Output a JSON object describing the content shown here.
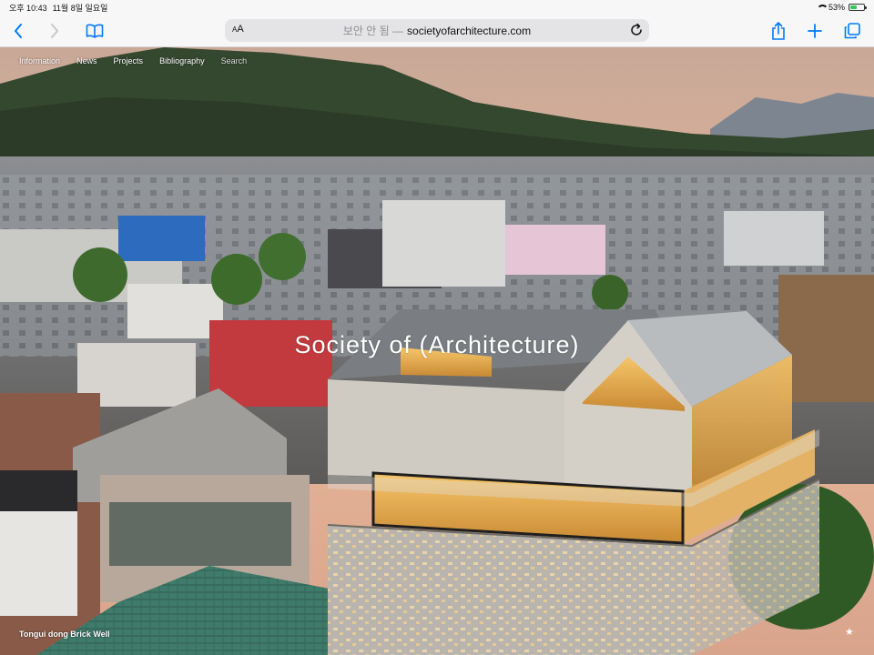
{
  "status_bar": {
    "time": "오후 10:43",
    "date": "11월 8일 일요일",
    "battery": "53%",
    "battery_level": 0.53
  },
  "browser": {
    "aa_label": "AA",
    "url_prefix": "보안 안 됨 —",
    "url": "societyofarchitecture.com",
    "icons": {
      "back": "chevron-left-icon",
      "forward": "chevron-right-icon",
      "bookmarks": "book-icon",
      "reload": "reload-icon",
      "share": "share-icon",
      "new_tab": "plus-icon",
      "tabs": "tabs-icon"
    }
  },
  "site": {
    "nav": [
      "Information",
      "News",
      "Projects",
      "Bibliography",
      "Search"
    ],
    "title": "Society of (Architecture)",
    "caption": "Tongui dong Brick Well",
    "star": "★"
  },
  "colors": {
    "accent": "#007aff",
    "battery_green": "#34c759"
  }
}
